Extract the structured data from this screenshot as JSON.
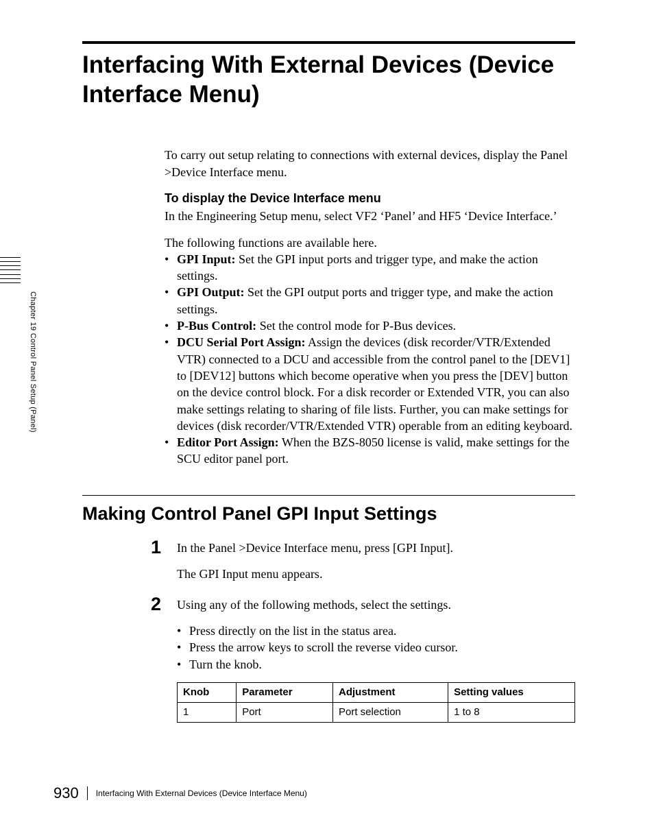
{
  "page_number": "930",
  "sidebar_text": "Chapter 19  Control Panel Setup (Panel)",
  "title": "Interfacing With External Devices (Device Interface Menu)",
  "intro": "To carry out setup relating to connections with external devices, display the Panel >Device Interface menu.",
  "display_heading": "To display the Device Interface menu",
  "display_text": "In the Engineering Setup menu, select VF2 ‘Panel’ and HF5 ‘Device Interface.’",
  "functions_intro": "The following functions are available here.",
  "functions": [
    {
      "name": "GPI Input:",
      "desc": " Set the GPI input ports and trigger type, and make the action settings."
    },
    {
      "name": "GPI Output:",
      "desc": " Set the GPI output ports and trigger type, and make the action settings."
    },
    {
      "name": "P-Bus Control:",
      "desc": " Set the control mode for P-Bus devices."
    },
    {
      "name": "DCU Serial Port Assign:",
      "desc": " Assign the devices (disk recorder/VTR/Extended VTR) connected to a DCU and accessible from the control panel to the [DEV1] to [DEV12] buttons which become operative when you press the [DEV] button on the device control block. For a disk recorder or Extended VTR, you can also make settings relating to sharing of file lists. Further, you can make settings for devices (disk recorder/VTR/Extended VTR) operable from an editing keyboard."
    },
    {
      "name": "Editor Port Assign:",
      "desc": " When the BZS-8050 license is valid, make settings for the SCU editor panel port."
    }
  ],
  "section_heading": "Making Control Panel GPI Input Settings",
  "steps": [
    {
      "num": "1",
      "lines": [
        "In the Panel >Device Interface menu, press [GPI Input].",
        "The GPI Input menu appears."
      ]
    },
    {
      "num": "2",
      "lines": [
        "Using any of the following methods, select the settings."
      ],
      "bullets": [
        "Press directly on the list in the status area.",
        "Press the arrow keys to scroll the reverse video cursor.",
        "Turn the knob."
      ]
    }
  ],
  "table": {
    "headers": [
      "Knob",
      "Parameter",
      "Adjustment",
      "Setting values"
    ],
    "rows": [
      [
        "1",
        "Port",
        "Port selection",
        "1 to 8"
      ]
    ]
  },
  "footer_title": "Interfacing With External Devices (Device Interface Menu)"
}
